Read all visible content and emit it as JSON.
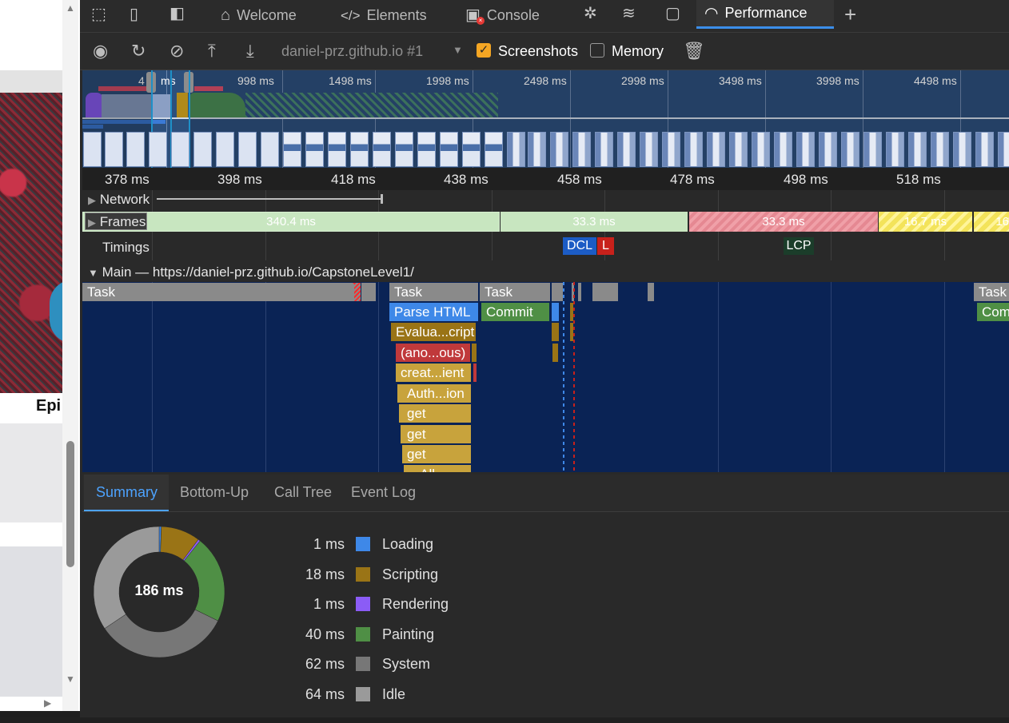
{
  "tabs": [
    {
      "label": "Welcome",
      "icon": "home-icon"
    },
    {
      "label": "Elements",
      "icon": "code-icon"
    },
    {
      "label": "Console",
      "icon": "console-icon"
    },
    {
      "label": "Performance",
      "icon": "performance-icon",
      "active": true
    }
  ],
  "toolbar": {
    "profile": "daniel-prz.github.io #1",
    "screenshots_label": "Screenshots",
    "screenshots_checked": true,
    "memory_label": "Memory",
    "memory_checked": false
  },
  "overview_ticks": [
    "4",
    "ms",
    "998 ms",
    "1498 ms",
    "1998 ms",
    "2498 ms",
    "2998 ms",
    "3498 ms",
    "3998 ms",
    "4498 ms"
  ],
  "ruler_ticks": [
    "378 ms",
    "398 ms",
    "418 ms",
    "438 ms",
    "458 ms",
    "478 ms",
    "498 ms",
    "518 ms"
  ],
  "tracks": {
    "network": "Network",
    "frames": "Frames",
    "timings": "Timings",
    "main": "Main — https://daniel-prz.github.io/CapstoneLevel1/"
  },
  "frames": [
    "340.4 ms",
    "33.3 ms",
    "33.3 ms",
    "16.7 ms",
    "16"
  ],
  "timings": [
    "DCL",
    "L",
    "LCP"
  ],
  "flame": {
    "task1": "Task",
    "task2": "Task",
    "task3": "Task",
    "task4": "Task",
    "parse_html": "Parse HTML",
    "commit1": "Commit",
    "commit2": "Com",
    "evaluate": "Evalua...cript",
    "anon": "(ano...ous)",
    "create": "creat...ient",
    "auth": "Auth...ion",
    "get1": "get",
    "get2": "get",
    "get3": "get",
    "cut": "...All..."
  },
  "bottom_tabs": [
    "Summary",
    "Bottom-Up",
    "Call Tree",
    "Event Log"
  ],
  "summary": {
    "total": "186 ms",
    "categories": [
      {
        "value": "1 ms",
        "name": "Loading",
        "color": "#3e88e8"
      },
      {
        "value": "18 ms",
        "name": "Scripting",
        "color": "#9a7416"
      },
      {
        "value": "1 ms",
        "name": "Rendering",
        "color": "#8b5cf6"
      },
      {
        "value": "40 ms",
        "name": "Painting",
        "color": "#4f8f45"
      },
      {
        "value": "62 ms",
        "name": "System",
        "color": "#777777"
      },
      {
        "value": "64 ms",
        "name": "Idle",
        "color": "#9a9a9a"
      }
    ]
  },
  "left_page": {
    "heading_fragment": "Epi"
  }
}
